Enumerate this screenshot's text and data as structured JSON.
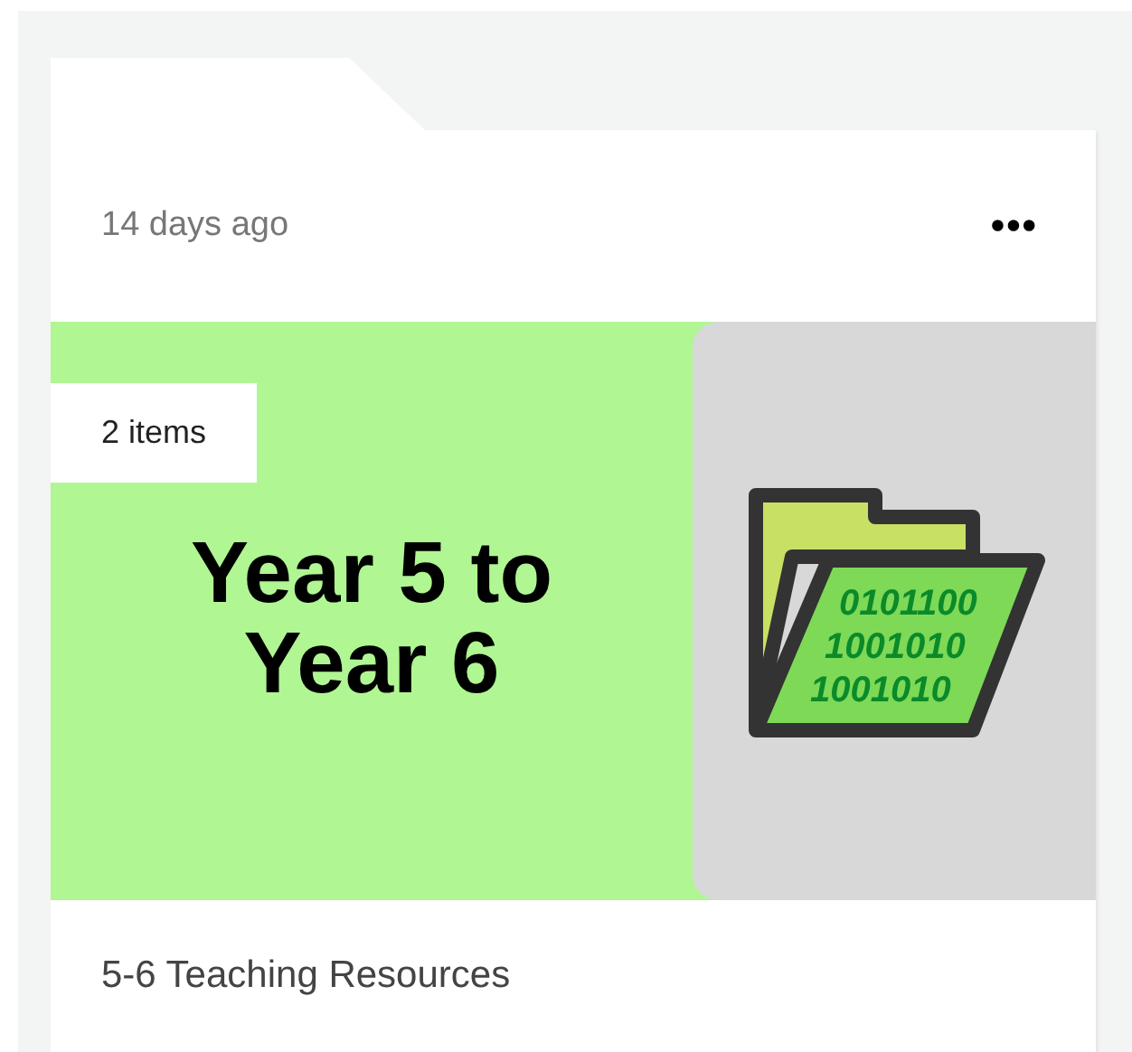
{
  "card": {
    "time": "14 days ago",
    "menu_icon": "•••",
    "item_count": "2 items",
    "cover_text": "Year 5 to Year 6",
    "binary_lines": [
      "0101100",
      "1001010",
      "1001010"
    ],
    "title": "5-6 Teaching Resources"
  }
}
